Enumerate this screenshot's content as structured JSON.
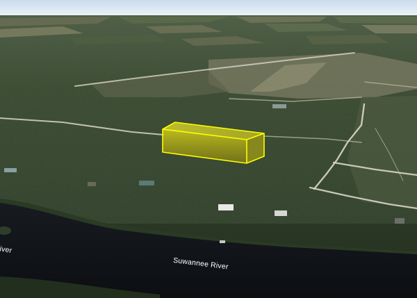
{
  "map": {
    "labels": {
      "river_main": "Suwannee River",
      "river_left_fragment": "River"
    },
    "overlay": {
      "shape": "extruded parcel box",
      "fill_color": "#c8c400",
      "stroke_color": "#ffff00"
    },
    "colors": {
      "sky": "#dfeaf3",
      "forest": "#2b3a24",
      "forest_dark": "#1c2718",
      "clearing": "#7d7a5e",
      "road": "#d8d4c4",
      "river": "#101318"
    }
  }
}
